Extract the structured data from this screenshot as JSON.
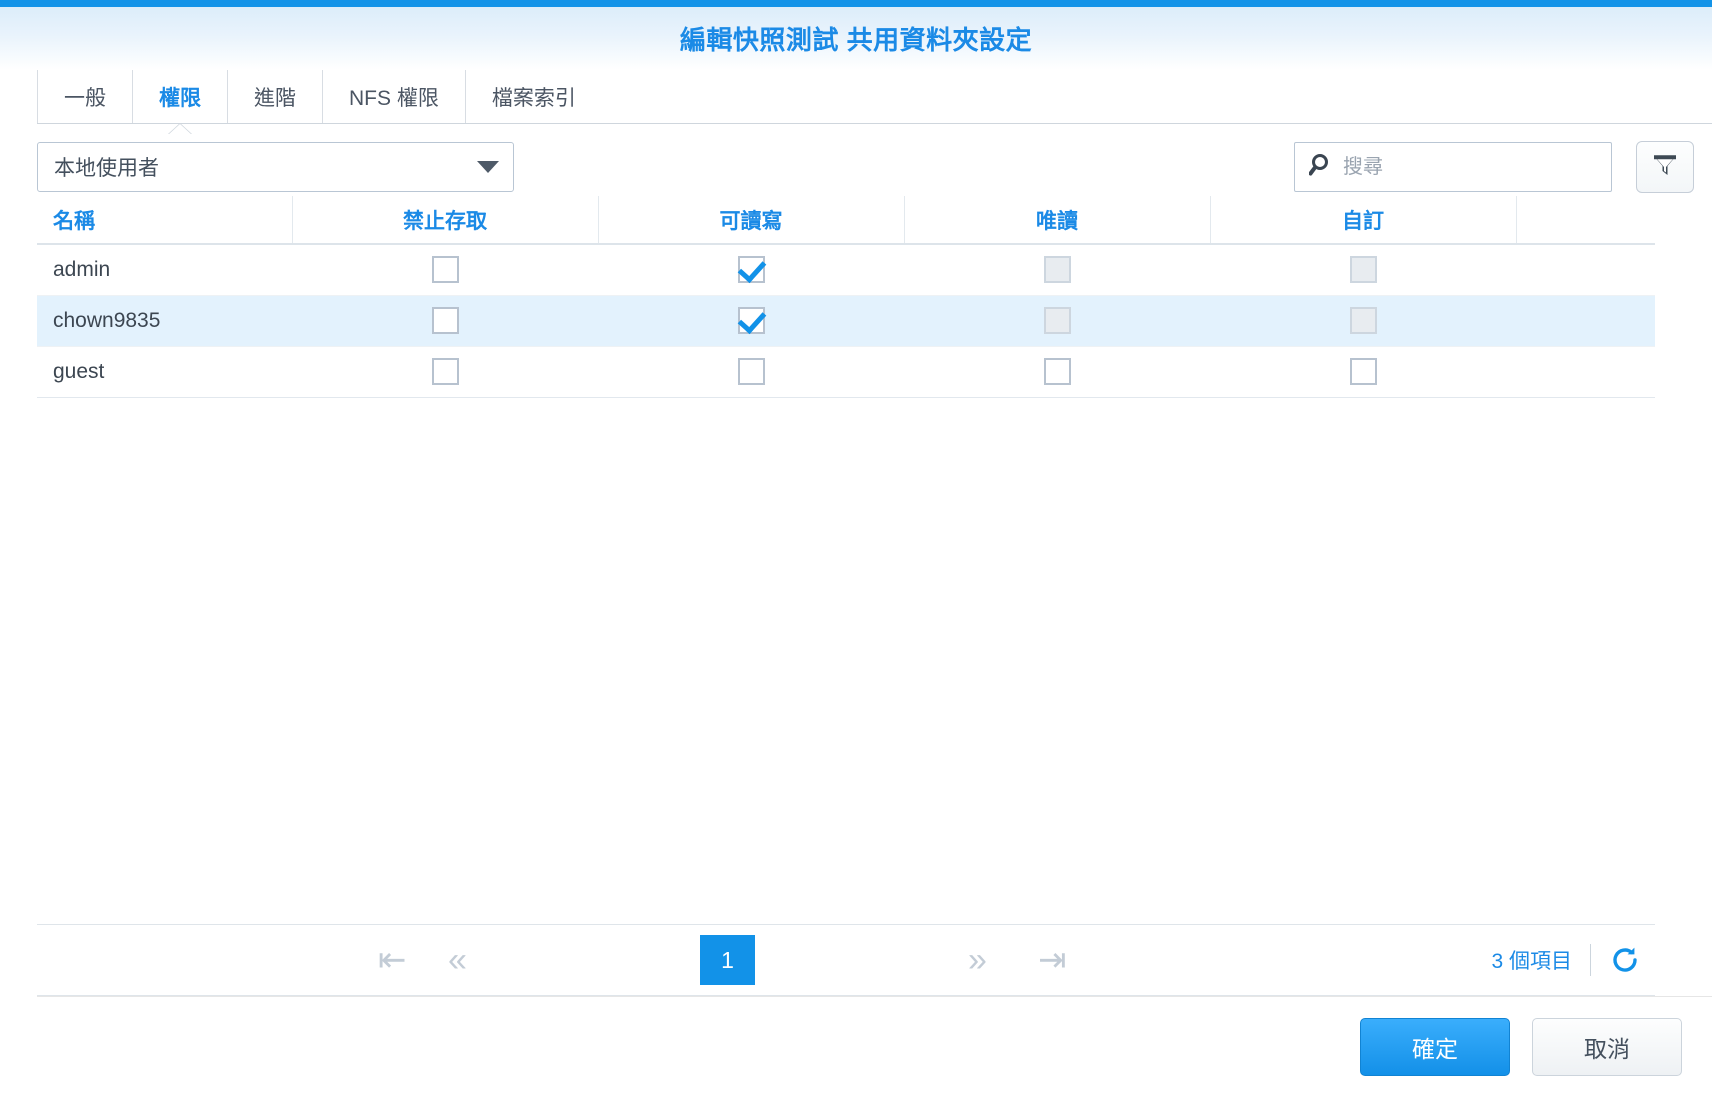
{
  "window": {
    "title": "編輯快照測試 共用資料夾設定",
    "accent_color": "#1293e8",
    "title_color": "#1b8ae6"
  },
  "tabs": [
    {
      "label": "一般",
      "active": false
    },
    {
      "label": "權限",
      "active": true
    },
    {
      "label": "進階",
      "active": false
    },
    {
      "label": "NFS 權限",
      "active": false
    },
    {
      "label": "檔案索引",
      "active": false
    }
  ],
  "toolbar": {
    "user_type_selected": "本地使用者",
    "search_placeholder": "搜尋",
    "search_value": "",
    "filter_icon": "funnel-icon",
    "search_icon": "search-icon",
    "caret_icon": "chevron-down-icon"
  },
  "table": {
    "columns": [
      "名稱",
      "禁止存取",
      "可讀寫",
      "唯讀",
      "自訂"
    ],
    "rows": [
      {
        "name": "admin",
        "selected": false,
        "no_access": {
          "checked": false,
          "disabled": false
        },
        "read_write": {
          "checked": true,
          "disabled": false
        },
        "read_only": {
          "checked": false,
          "disabled": true
        },
        "custom": {
          "checked": false,
          "disabled": true
        }
      },
      {
        "name": "chown9835",
        "selected": true,
        "no_access": {
          "checked": false,
          "disabled": false
        },
        "read_write": {
          "checked": true,
          "disabled": false
        },
        "read_only": {
          "checked": false,
          "disabled": true
        },
        "custom": {
          "checked": false,
          "disabled": true
        }
      },
      {
        "name": "guest",
        "selected": false,
        "no_access": {
          "checked": false,
          "disabled": false
        },
        "read_write": {
          "checked": false,
          "disabled": false
        },
        "read_only": {
          "checked": false,
          "disabled": false
        },
        "custom": {
          "checked": false,
          "disabled": false
        }
      }
    ]
  },
  "pagination": {
    "first_icon": "first-page-icon",
    "prev_icon": "previous-page-icon",
    "next_icon": "next-page-icon",
    "last_icon": "last-page-icon",
    "current_page": "1",
    "item_count": "3 個項目",
    "refresh_icon": "refresh-icon"
  },
  "footer": {
    "confirm_label": "確定",
    "cancel_label": "取消"
  }
}
